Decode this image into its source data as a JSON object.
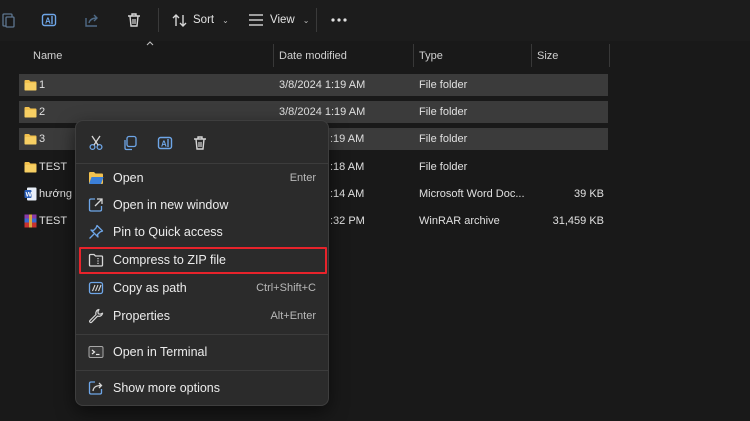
{
  "toolbar": {
    "sort_label": "Sort",
    "view_label": "View",
    "icons": [
      "paste-icon",
      "rename-icon",
      "share-icon",
      "delete-icon",
      "sort-icon",
      "view-icon",
      "more-icon"
    ]
  },
  "columns": {
    "name": "Name",
    "date": "Date modified",
    "type": "Type",
    "size": "Size"
  },
  "rows": [
    {
      "name": "1",
      "date": "3/8/2024 1:19 AM",
      "type": "File folder",
      "size": "",
      "icon": "folder-icon",
      "selected": true
    },
    {
      "name": "2",
      "date": "3/8/2024 1:19 AM",
      "type": "File folder",
      "size": "",
      "icon": "folder-icon",
      "selected": true
    },
    {
      "name": "3",
      "date": ":19 AM",
      "type": "File folder",
      "size": "",
      "icon": "folder-icon",
      "selected": true
    },
    {
      "name": "TEST",
      "date": ":18 AM",
      "type": "File folder",
      "size": "",
      "icon": "folder-icon",
      "selected": false
    },
    {
      "name": "hướng",
      "date": ":14 AM",
      "type": "Microsoft Word Doc...",
      "size": "39 KB",
      "icon": "word-doc-icon",
      "selected": false
    },
    {
      "name": "TEST",
      "date": ":32 PM",
      "type": "WinRAR archive",
      "size": "31,459 KB",
      "icon": "winrar-icon",
      "selected": false
    }
  ],
  "context_menu": {
    "quick_actions": [
      "cut-icon",
      "copy-icon",
      "rename-icon",
      "delete-icon"
    ],
    "items": [
      {
        "label": "Open",
        "shortcut": "Enter",
        "icon": "open-folder-icon"
      },
      {
        "label": "Open in new window",
        "shortcut": "",
        "icon": "new-window-icon"
      },
      {
        "label": "Pin to Quick access",
        "shortcut": "",
        "icon": "pin-icon"
      },
      {
        "label": "Compress to ZIP file",
        "shortcut": "",
        "icon": "zip-icon",
        "highlighted": true
      },
      {
        "label": "Copy as path",
        "shortcut": "Ctrl+Shift+C",
        "icon": "copy-path-icon"
      },
      {
        "label": "Properties",
        "shortcut": "Alt+Enter",
        "icon": "wrench-icon"
      },
      {
        "label": "Open in Terminal",
        "shortcut": "",
        "icon": "terminal-icon"
      },
      {
        "label": "Show more options",
        "shortcut": "",
        "icon": "share-more-icon"
      }
    ]
  },
  "colors": {
    "background": "#191919",
    "selection": "#3b3b3b",
    "menu_bg": "#2b2b2b",
    "highlight_border": "#e8232b",
    "folder": "#f2c14e"
  }
}
